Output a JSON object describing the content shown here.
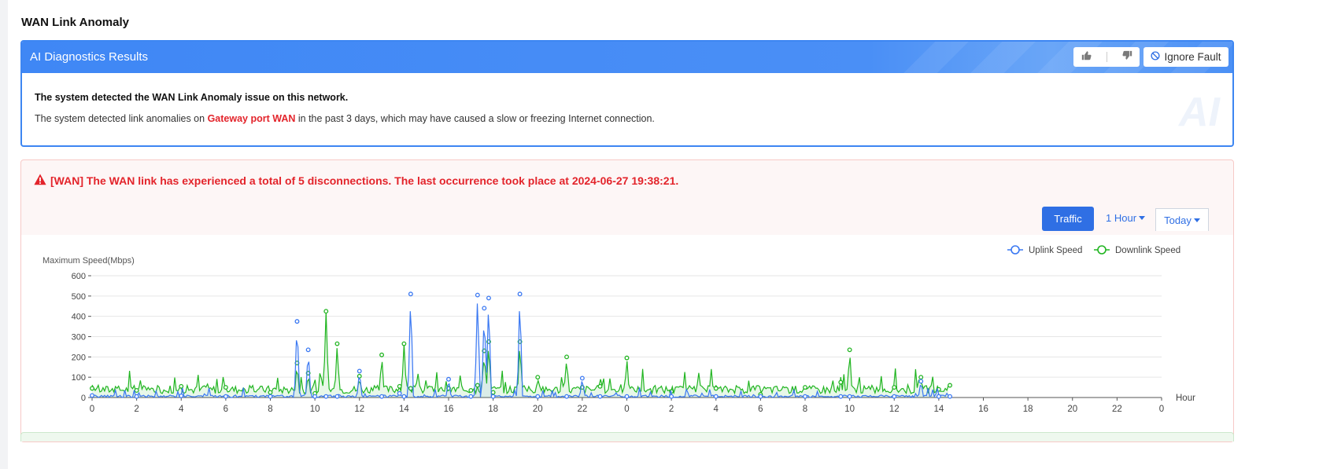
{
  "page": {
    "title": "WAN Link Anomaly"
  },
  "diagnostics": {
    "title": "AI Diagnostics Results",
    "ignore_label": "Ignore Fault",
    "summary": "The system detected the WAN Link Anomaly issue on this network.",
    "detail_prefix": "The system detected link anomalies on ",
    "detail_highlight": "Gateway port WAN",
    "detail_suffix": " in the past 3 days, which may have caused a slow or freezing Internet connection.",
    "watermark": "AI",
    "icons": {
      "like": "thumbs-up-icon",
      "dislike": "thumbs-down-icon",
      "ignore": "ban-icon"
    }
  },
  "alert": {
    "message": "[WAN] The WAN link has experienced a total of 5 disconnections. The last occurrence took place at 2024-06-27 19:38:21.",
    "icon": "warning-triangle-icon",
    "color": "#e3242b"
  },
  "controls": {
    "traffic_label": "Traffic",
    "interval_label": "1 Hour",
    "range_label": "Today"
  },
  "chart_data": {
    "type": "line",
    "ylabel": "Maximum Speed(Mbps)",
    "xlabel": "Hour",
    "ylim": [
      0,
      600
    ],
    "yticks": [
      0,
      100,
      200,
      300,
      400,
      500,
      600
    ],
    "xticks": [
      "0",
      "2",
      "4",
      "6",
      "8",
      "10",
      "12",
      "14",
      "16",
      "18",
      "20",
      "22",
      "0",
      "2",
      "4",
      "6",
      "8",
      "10",
      "12",
      "14",
      "16",
      "18",
      "20",
      "22",
      "0"
    ],
    "x": [
      0,
      2,
      4,
      6,
      8,
      9.2,
      9.7,
      10,
      10.5,
      11,
      12,
      13,
      13.8,
      14,
      14.3,
      16,
      17,
      17.3,
      17.6,
      17.8,
      18,
      19.2,
      20,
      21.3,
      22,
      22.8,
      24,
      26,
      28,
      30,
      32,
      33.6,
      34,
      36,
      37.2,
      38,
      38.5
    ],
    "series": [
      {
        "name": "Uplink Speed",
        "color": "#3a78f2",
        "values": [
          10,
          5,
          8,
          5,
          5,
          375,
          235,
          5,
          5,
          5,
          130,
          5,
          20,
          5,
          510,
          90,
          5,
          505,
          440,
          490,
          5,
          510,
          5,
          5,
          95,
          5,
          5,
          5,
          5,
          5,
          5,
          5,
          5,
          5,
          80,
          5,
          5
        ]
      },
      {
        "name": "Downlink Speed",
        "color": "#21b521",
        "values": [
          45,
          35,
          55,
          50,
          25,
          170,
          120,
          20,
          425,
          265,
          105,
          210,
          55,
          265,
          45,
          45,
          35,
          60,
          230,
          275,
          25,
          275,
          100,
          200,
          50,
          55,
          195,
          30,
          45,
          15,
          50,
          75,
          235,
          50,
          100,
          40,
          60
        ]
      }
    ],
    "grid": "horizontal",
    "legend": "top-right",
    "x_range_days": 2
  }
}
